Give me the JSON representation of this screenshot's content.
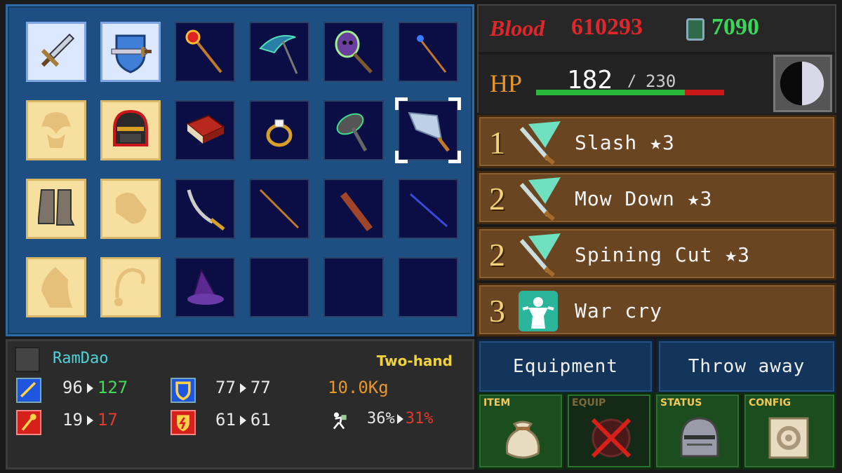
{
  "currency": {
    "blood_label": "Blood",
    "blood_value": "610293",
    "gems_value": "7090"
  },
  "hp": {
    "label": "HP",
    "current": "182",
    "separator": "/",
    "max": "230",
    "fill_fraction": 0.79
  },
  "skills": [
    {
      "rank": "1",
      "name": "Slash ★3",
      "icon": "sword-slash-icon"
    },
    {
      "rank": "2",
      "name": "Mow Down ★3",
      "icon": "sword-slash-icon"
    },
    {
      "rank": "2",
      "name": "Spining Cut ★3",
      "icon": "sword-slash-icon"
    },
    {
      "rank": "3",
      "name": "War cry",
      "icon": "war-cry-icon"
    }
  ],
  "item_info": {
    "name": "RamDao",
    "type": "Two-hand",
    "attack": {
      "from": "96",
      "to": "127"
    },
    "defense": {
      "from": "77",
      "to": "77"
    },
    "magic": {
      "from": "19",
      "to": "17"
    },
    "magic_def": {
      "from": "61",
      "to": "61"
    },
    "weight": "10.0Kg",
    "load": {
      "from": "36%",
      "to": "31%"
    }
  },
  "actions": {
    "equipment": "Equipment",
    "throw_away": "Throw away"
  },
  "menu": {
    "item": "ITEM",
    "equip": "EQUIP",
    "status": "STATUS",
    "config": "CONFIG"
  },
  "colors": {
    "blood": "#e0262a",
    "gems": "#39d65a",
    "stat_up": "#3fdc57",
    "stat_down": "#e23b2b",
    "weight": "#e8962a",
    "type": "#f2d23a",
    "name": "#4fd3d8"
  }
}
